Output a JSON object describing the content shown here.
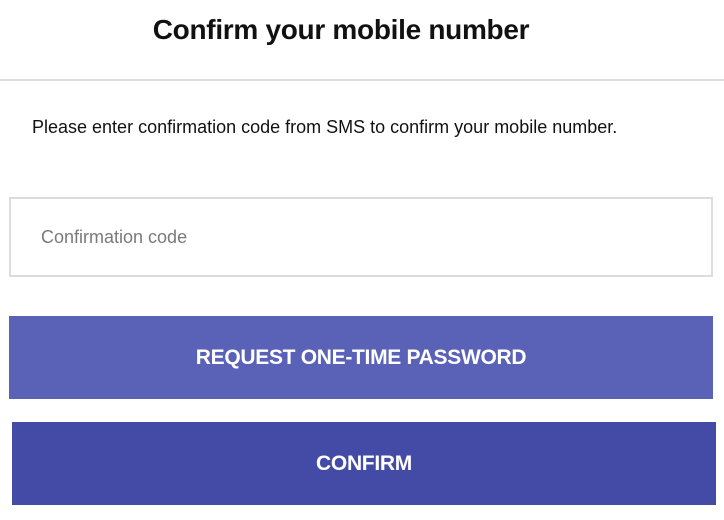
{
  "header": {
    "title": "Confirm your mobile number"
  },
  "body": {
    "message": "Please enter confirmation code from SMS to confirm your mobile number.",
    "code_input": {
      "placeholder": "Confirmation code",
      "value": ""
    }
  },
  "actions": {
    "request_otp_label": "REQUEST ONE-TIME PASSWORD",
    "confirm_label": "CONFIRM"
  },
  "colors": {
    "request_button": "#5a62b8",
    "confirm_button": "#444ba6",
    "input_border": "#dcdcdc",
    "divider": "#dddddd"
  }
}
